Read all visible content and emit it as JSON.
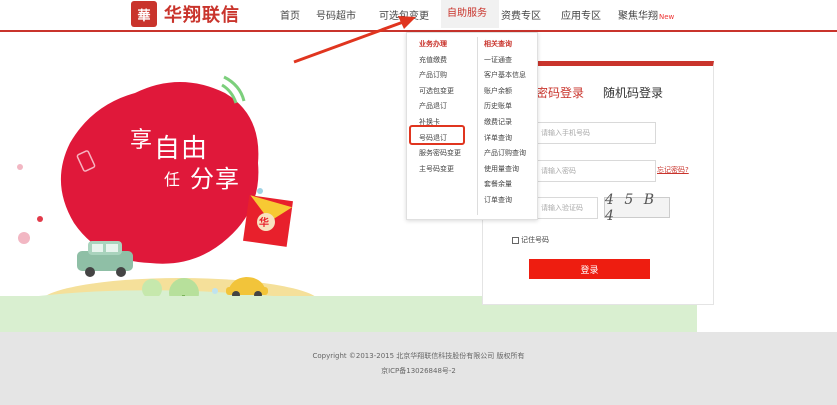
{
  "header": {
    "logo_mark": "華",
    "logo_text": "华翔联信",
    "nav": [
      {
        "label": "首页"
      },
      {
        "label": "号码超市"
      },
      {
        "label": "可选包变更"
      },
      {
        "label": "自助服务",
        "active": true
      },
      {
        "label": "资费专区"
      },
      {
        "label": "应用专区"
      },
      {
        "label": "聚焦华翔",
        "badge": "New"
      }
    ]
  },
  "dropdown": {
    "left_head": "业务办理",
    "left_items": [
      "充值缴费",
      "产品订购",
      "可选包变更",
      "产品退订",
      "补换卡",
      "号码退订",
      "服务密码变更",
      "主号码变更"
    ],
    "right_head": "相关查询",
    "right_items": [
      "一证通查",
      "客户基本信息",
      "账户余额",
      "历史账单",
      "缴费记录",
      "详单查询",
      "产品订购查询",
      "使用量查询",
      "套餐余量",
      "订单查询"
    ],
    "highlighted_item": "号码退订"
  },
  "hero": {
    "slogan_top": "享",
    "slogan_big": "自由",
    "slogan_mid": "任",
    "slogan_end": "分享",
    "envelope_char": "华"
  },
  "login": {
    "tab_password": "密码登录",
    "tab_random": "随机码登录",
    "phone_placeholder": "请输入手机号码",
    "password_placeholder": "请输入密码",
    "code_placeholder": "请输入验证码",
    "forgot_label": "忘记密码?",
    "captcha_text": "4 5 B 4",
    "remember_label": "记住号码",
    "submit_label": "登录"
  },
  "footer": {
    "copyright": "Copyright ©2013-2015 北京华翔联信科技股份有限公司 版权所有",
    "icp": "京ICP备13026848号-2"
  },
  "colors": {
    "brand": "#c9342c",
    "button": "#ee1d10",
    "footer_bg": "#e5e5e5"
  }
}
